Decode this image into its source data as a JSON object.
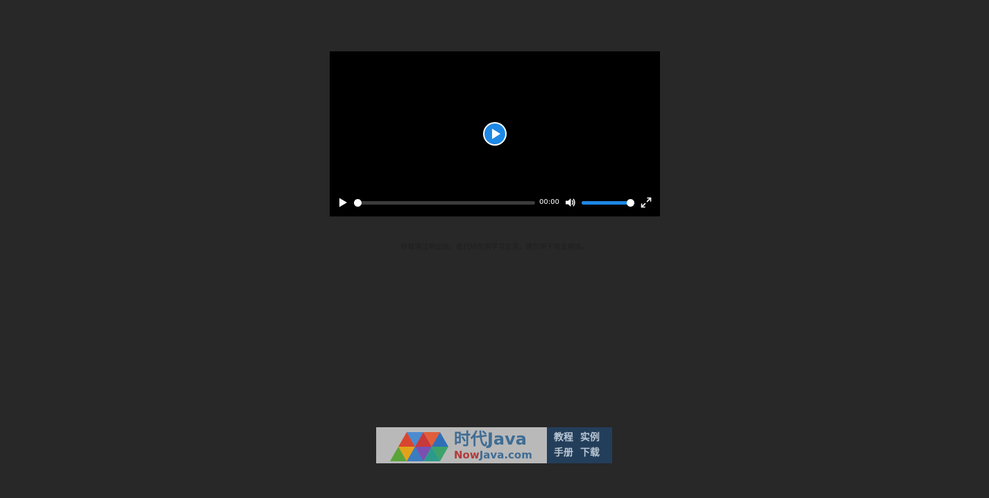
{
  "player": {
    "current_time": "00:00",
    "progress": 0,
    "volume": 1.0,
    "icons": {
      "big_play": "play-circle-icon",
      "play": "play-icon",
      "mute": "volume-icon",
      "fullscreen": "fullscreen-icon"
    },
    "colors": {
      "accent": "#1e88e5",
      "background": "#000000"
    }
  },
  "notice": {
    "text": "转载请注明出处。此代码仅供学习交流，请勿用于商业用途。"
  },
  "banner": {
    "title": "时代Java",
    "domain_brand": "Now",
    "domain_rest": "Java.com",
    "links": [
      "教程",
      "实例",
      "手册",
      "下载"
    ]
  },
  "colors": {
    "page_background": "#282828"
  }
}
